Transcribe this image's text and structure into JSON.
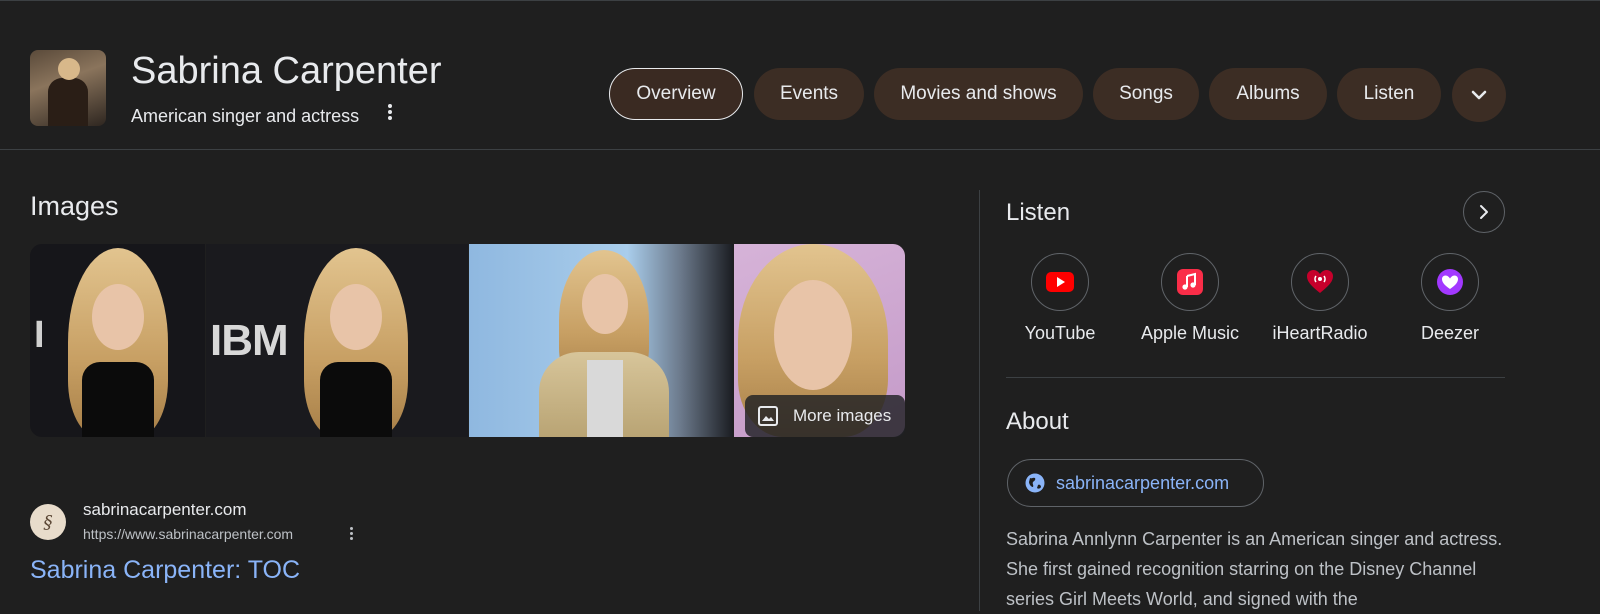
{
  "header": {
    "title": "Sabrina Carpenter",
    "subtitle": "American singer and actress",
    "tabs": [
      {
        "label": "Overview",
        "active": true
      },
      {
        "label": "Events"
      },
      {
        "label": "Movies and shows"
      },
      {
        "label": "Songs"
      },
      {
        "label": "Albums"
      },
      {
        "label": "Listen"
      }
    ]
  },
  "images": {
    "title": "Images",
    "more_label": "More images"
  },
  "result": {
    "site_name": "sabrinacarpenter.com",
    "url": "https://www.sabrinacarpenter.com",
    "title": "Sabrina Carpenter: TOC"
  },
  "listen": {
    "title": "Listen",
    "services": [
      {
        "name": "YouTube",
        "icon": "youtube-icon",
        "color": "#ff0000"
      },
      {
        "name": "Apple Music",
        "icon": "apple-music-icon",
        "color": "#fa2d48"
      },
      {
        "name": "iHeartRadio",
        "icon": "iheartradio-icon",
        "color": "#c6002b"
      },
      {
        "name": "Deezer",
        "icon": "deezer-icon",
        "color": "#a238ff"
      }
    ]
  },
  "about": {
    "title": "About",
    "website": "sabrinacarpenter.com",
    "description": "Sabrina Annlynn Carpenter is an American singer and actress. She first gained recognition starring on the Disney Channel series Girl Meets World, and signed with the"
  },
  "colors": {
    "background": "#1f1f1f",
    "chip": "#3c2d24",
    "link": "#8ab4f8",
    "text": "#e8eaed"
  }
}
